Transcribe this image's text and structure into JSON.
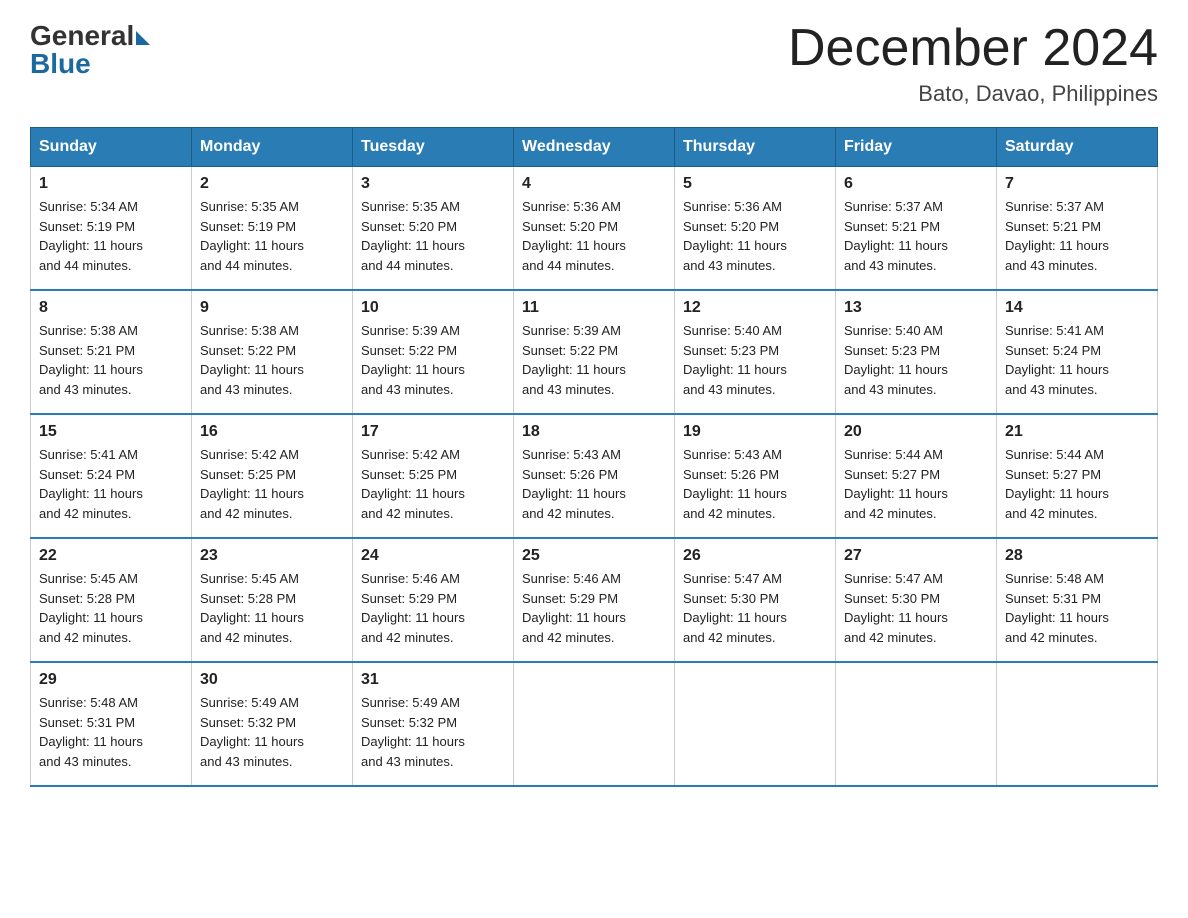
{
  "header": {
    "logo": {
      "general": "General",
      "blue": "Blue"
    },
    "title": "December 2024",
    "subtitle": "Bato, Davao, Philippines"
  },
  "calendar": {
    "weekdays": [
      "Sunday",
      "Monday",
      "Tuesday",
      "Wednesday",
      "Thursday",
      "Friday",
      "Saturday"
    ],
    "weeks": [
      [
        {
          "day": "1",
          "sunrise": "5:34 AM",
          "sunset": "5:19 PM",
          "daylight": "11 hours and 44 minutes."
        },
        {
          "day": "2",
          "sunrise": "5:35 AM",
          "sunset": "5:19 PM",
          "daylight": "11 hours and 44 minutes."
        },
        {
          "day": "3",
          "sunrise": "5:35 AM",
          "sunset": "5:20 PM",
          "daylight": "11 hours and 44 minutes."
        },
        {
          "day": "4",
          "sunrise": "5:36 AM",
          "sunset": "5:20 PM",
          "daylight": "11 hours and 44 minutes."
        },
        {
          "day": "5",
          "sunrise": "5:36 AM",
          "sunset": "5:20 PM",
          "daylight": "11 hours and 43 minutes."
        },
        {
          "day": "6",
          "sunrise": "5:37 AM",
          "sunset": "5:21 PM",
          "daylight": "11 hours and 43 minutes."
        },
        {
          "day": "7",
          "sunrise": "5:37 AM",
          "sunset": "5:21 PM",
          "daylight": "11 hours and 43 minutes."
        }
      ],
      [
        {
          "day": "8",
          "sunrise": "5:38 AM",
          "sunset": "5:21 PM",
          "daylight": "11 hours and 43 minutes."
        },
        {
          "day": "9",
          "sunrise": "5:38 AM",
          "sunset": "5:22 PM",
          "daylight": "11 hours and 43 minutes."
        },
        {
          "day": "10",
          "sunrise": "5:39 AM",
          "sunset": "5:22 PM",
          "daylight": "11 hours and 43 minutes."
        },
        {
          "day": "11",
          "sunrise": "5:39 AM",
          "sunset": "5:22 PM",
          "daylight": "11 hours and 43 minutes."
        },
        {
          "day": "12",
          "sunrise": "5:40 AM",
          "sunset": "5:23 PM",
          "daylight": "11 hours and 43 minutes."
        },
        {
          "day": "13",
          "sunrise": "5:40 AM",
          "sunset": "5:23 PM",
          "daylight": "11 hours and 43 minutes."
        },
        {
          "day": "14",
          "sunrise": "5:41 AM",
          "sunset": "5:24 PM",
          "daylight": "11 hours and 43 minutes."
        }
      ],
      [
        {
          "day": "15",
          "sunrise": "5:41 AM",
          "sunset": "5:24 PM",
          "daylight": "11 hours and 42 minutes."
        },
        {
          "day": "16",
          "sunrise": "5:42 AM",
          "sunset": "5:25 PM",
          "daylight": "11 hours and 42 minutes."
        },
        {
          "day": "17",
          "sunrise": "5:42 AM",
          "sunset": "5:25 PM",
          "daylight": "11 hours and 42 minutes."
        },
        {
          "day": "18",
          "sunrise": "5:43 AM",
          "sunset": "5:26 PM",
          "daylight": "11 hours and 42 minutes."
        },
        {
          "day": "19",
          "sunrise": "5:43 AM",
          "sunset": "5:26 PM",
          "daylight": "11 hours and 42 minutes."
        },
        {
          "day": "20",
          "sunrise": "5:44 AM",
          "sunset": "5:27 PM",
          "daylight": "11 hours and 42 minutes."
        },
        {
          "day": "21",
          "sunrise": "5:44 AM",
          "sunset": "5:27 PM",
          "daylight": "11 hours and 42 minutes."
        }
      ],
      [
        {
          "day": "22",
          "sunrise": "5:45 AM",
          "sunset": "5:28 PM",
          "daylight": "11 hours and 42 minutes."
        },
        {
          "day": "23",
          "sunrise": "5:45 AM",
          "sunset": "5:28 PM",
          "daylight": "11 hours and 42 minutes."
        },
        {
          "day": "24",
          "sunrise": "5:46 AM",
          "sunset": "5:29 PM",
          "daylight": "11 hours and 42 minutes."
        },
        {
          "day": "25",
          "sunrise": "5:46 AM",
          "sunset": "5:29 PM",
          "daylight": "11 hours and 42 minutes."
        },
        {
          "day": "26",
          "sunrise": "5:47 AM",
          "sunset": "5:30 PM",
          "daylight": "11 hours and 42 minutes."
        },
        {
          "day": "27",
          "sunrise": "5:47 AM",
          "sunset": "5:30 PM",
          "daylight": "11 hours and 42 minutes."
        },
        {
          "day": "28",
          "sunrise": "5:48 AM",
          "sunset": "5:31 PM",
          "daylight": "11 hours and 42 minutes."
        }
      ],
      [
        {
          "day": "29",
          "sunrise": "5:48 AM",
          "sunset": "5:31 PM",
          "daylight": "11 hours and 43 minutes."
        },
        {
          "day": "30",
          "sunrise": "5:49 AM",
          "sunset": "5:32 PM",
          "daylight": "11 hours and 43 minutes."
        },
        {
          "day": "31",
          "sunrise": "5:49 AM",
          "sunset": "5:32 PM",
          "daylight": "11 hours and 43 minutes."
        },
        null,
        null,
        null,
        null
      ]
    ],
    "labels": {
      "sunrise": "Sunrise:",
      "sunset": "Sunset:",
      "daylight": "Daylight:"
    }
  }
}
